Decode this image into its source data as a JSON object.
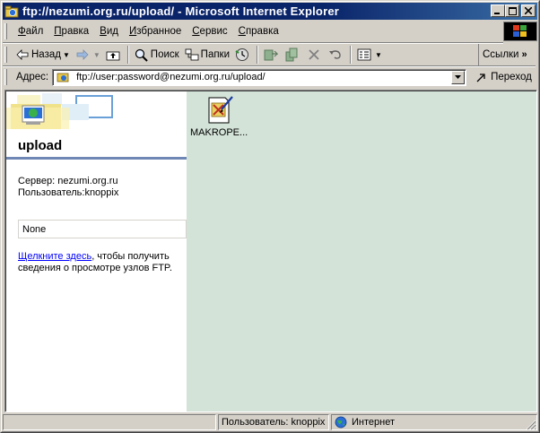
{
  "window": {
    "title": "ftp://nezumi.org.ru/upload/ - Microsoft Internet Explorer",
    "minimize_glyph": "_",
    "maximize_glyph": "□",
    "close_glyph": "✕"
  },
  "menu": [
    {
      "accel": "Ф",
      "rest": "айл"
    },
    {
      "accel": "П",
      "rest": "равка"
    },
    {
      "accel": "В",
      "rest": "ид"
    },
    {
      "accel": "И",
      "rest": "збранное"
    },
    {
      "accel": "С",
      "rest": "ервис"
    },
    {
      "accel": "С",
      "rest": "правка"
    }
  ],
  "toolbar": {
    "back_label": "Назад",
    "search_label": "Поиск",
    "folders_label": "Папки",
    "links_label": "Ссылки"
  },
  "address": {
    "label": "Адрес:",
    "url": "ftp://user:password@nezumi.org.ru/upload/",
    "go_label": "Переход"
  },
  "leftpane": {
    "folder_title": "upload",
    "server_line": "Сервер: nezumi.org.ru",
    "user_line": "Пользователь:knoppix",
    "box_value": "None",
    "link_text": "Щелкните здесь",
    "help_rest": ", чтобы получить сведения о просмотре узлов FTP."
  },
  "files": [
    {
      "name": "MAKROPE..."
    }
  ],
  "status": {
    "user": "Пользователь: knoppix",
    "zone": "Интернет"
  },
  "colors": {
    "title_bar": "#0a246a",
    "content_bg": "#d3e3d8",
    "banner_line": "#6f87b5",
    "link": "#0000ff"
  },
  "icons": {
    "app": "ie-folder-icon",
    "back": "back-arrow-icon",
    "forward": "forward-arrow-icon",
    "up": "up-folder-icon",
    "search": "search-icon",
    "folders": "folders-icon",
    "history": "history-icon",
    "move_to": "move-to-icon",
    "copy_to": "copy-to-icon",
    "delete": "delete-icon",
    "undo": "undo-icon",
    "views": "views-icon",
    "go": "go-arrow-icon",
    "internet_zone": "globe-icon"
  }
}
